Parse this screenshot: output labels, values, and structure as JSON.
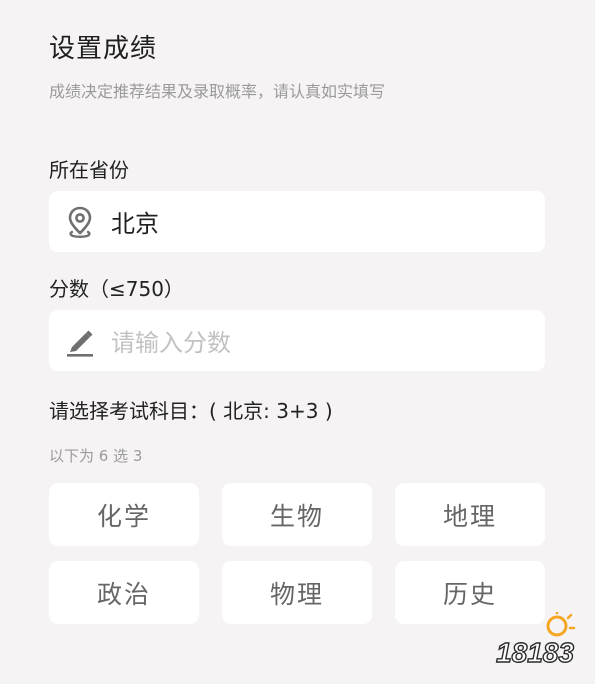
{
  "header": {
    "title": "设置成绩",
    "subtitle": "成绩决定推荐结果及录取概率，请认真如实填写"
  },
  "province": {
    "label": "所在省份",
    "value": "北京",
    "icon": "location-pin-icon"
  },
  "score": {
    "label": "分数（≤750）",
    "placeholder": "请输入分数",
    "icon": "pencil-icon"
  },
  "subjects": {
    "label": "请选择考试科目：( 北京: 3+3 )",
    "hint": "以下为 6 选 3",
    "options": [
      "化学",
      "生物",
      "地理",
      "政治",
      "物理",
      "历史"
    ]
  },
  "watermark": {
    "text": "18183"
  },
  "colors": {
    "background": "#f6f3f4",
    "card": "#ffffff",
    "placeholder": "#c2c2c2",
    "subtle_text": "#9a9a9a",
    "watermark_orange": "#f5a623"
  }
}
